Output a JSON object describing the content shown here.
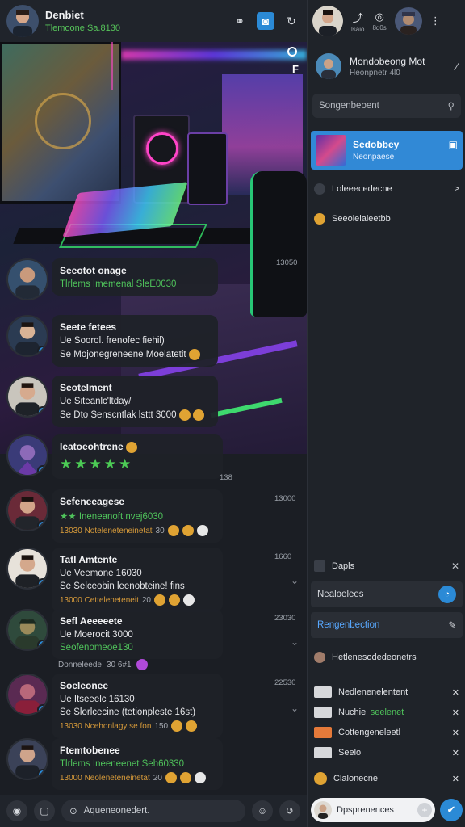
{
  "colors": {
    "accent": "#2b8ad6",
    "online": "#4fc35b",
    "panel": "#1f2329"
  },
  "header": {
    "title": "Denbiet",
    "subtitle": "Tlemoone Sa.8130",
    "icons": [
      "link-icon",
      "camera-icon",
      "refresh-icon"
    ]
  },
  "hero": {
    "corner_label": "F"
  },
  "messages": [
    {
      "name": "Seeotot onage",
      "lines": [
        {
          "text": "Tlrlems Imemenal SleE0030",
          "style": "green"
        }
      ],
      "time": "13050"
    },
    {
      "name": "Seete fetees",
      "lines": [
        {
          "text": "Ue Soorol. frenofec fiehil)",
          "style": ""
        },
        {
          "text": "Se Mojonegreneene Moelatetit",
          "style": ""
        }
      ]
    },
    {
      "name": "Seotelment",
      "lines": [
        {
          "text": "Ue Siteanlc'ltday/",
          "style": ""
        },
        {
          "text": "Se Dto Senscntlak lsttt 3000",
          "style": ""
        }
      ]
    },
    {
      "name": "Ieatoeohtrene",
      "time": "138",
      "stars": "★★★★★",
      "star_tail": "0"
    },
    {
      "name": "Sefeneeagese",
      "lines": [
        {
          "text": "★★ Ineneanoft nvej6030",
          "style": "green"
        }
      ],
      "meta": "13030 Noteleneteneinetat",
      "meta_num": "30",
      "time": "13000"
    },
    {
      "name": "Tatl Amtente",
      "lines": [
        {
          "text": "Ue Veemone 16030",
          "style": ""
        },
        {
          "text": "Se Selceobin leenobteine! fins",
          "style": ""
        }
      ],
      "meta": "13000 Cetteleneteneit",
      "meta_num": "20",
      "time": "1660"
    },
    {
      "name": "Sefl Aeeeeete",
      "lines": [
        {
          "text": "Ue Moerocit 3000",
          "style": ""
        },
        {
          "text": "Seofenomeoe130",
          "style": "green"
        }
      ],
      "meta": "Donneleede",
      "meta_num": "30 6#1",
      "time": "23030"
    },
    {
      "name": "Soeleonee",
      "lines": [
        {
          "text": "Ue Itseeelc 16130",
          "style": ""
        },
        {
          "text": "Se Slorlcecine (tetionpleste 16st)",
          "style": ""
        }
      ],
      "meta": "13030 Ncehonlagy se fon",
      "meta_num": "150",
      "time": "22530"
    },
    {
      "name": "Ftemtobenee",
      "lines": [
        {
          "text": "Tlrlems Ineeneenet Seh60330",
          "style": "green"
        }
      ],
      "meta": "13000 Neoleneteneinetat",
      "meta_num": "20",
      "time": ""
    }
  ],
  "composer": {
    "placeholder": "Aqueneonedert."
  },
  "right": {
    "top_icons": [
      {
        "name": "share-icon",
        "label": "lsaio"
      },
      {
        "name": "camera-icon",
        "label": "8d0s"
      }
    ],
    "profile": {
      "name": "Mondobeong Mot",
      "status": "Heonpnetr 4l0"
    },
    "search_placeholder": "Songenbeoent",
    "active_chat": {
      "title": "Sedobbey",
      "subtitle": "Neonpaese"
    },
    "rows": [
      {
        "label": "Loleeecedecne",
        "trailing": ">"
      },
      {
        "label": "Seeolelaleetbb",
        "trailing": ""
      }
    ],
    "section_title": "Dapls",
    "field_one": "Nealoelees",
    "field_two": "Rengenbection",
    "list_heading": "Hetlenesodedeonetrs",
    "items": [
      {
        "label": "Nedlenenelentent",
        "accent": "",
        "sq": "light"
      },
      {
        "label": "Nuchiel",
        "accent": "seelenet",
        "sq": "light"
      },
      {
        "label": "Cottengeneleetl",
        "accent": "",
        "sq": "orange"
      },
      {
        "label": "Seelo",
        "accent": "",
        "sq": "light"
      },
      {
        "label": "Clalonecne",
        "accent": "",
        "sq": "dot"
      }
    ],
    "composer_placeholder": "Dpsprenences"
  }
}
